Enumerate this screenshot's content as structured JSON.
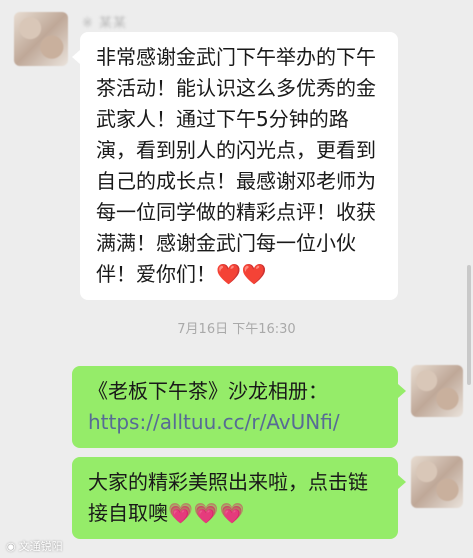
{
  "messages": {
    "incoming": {
      "sender_name": "※ 某某",
      "text_main": "非常感谢金武门下午举办的下午茶活动！能认识这么多优秀的金武家人！通过下午5分钟的路演，看到别人的闪光点，更看到自己的成长点！最感谢邓老师为每一位同学做的精彩点评！收获满满！感谢金武门每一位小伙伴！爱你们！",
      "emoji": "❤️❤️"
    },
    "timestamp": "7月16日 下午16:30",
    "outgoing": [
      {
        "prefix": "《老板下午茶》沙龙相册：",
        "link": "https://alltuu.cc/r/AvUNfi/"
      },
      {
        "text": "大家的精彩美照出来啦，点击链接自取噢",
        "emoji": "💗💗💗"
      }
    ]
  },
  "watermark": {
    "icon": "weibo-icon",
    "text": "文通锐阳"
  },
  "colors": {
    "background": "#ededed",
    "incoming_bubble": "#ffffff",
    "outgoing_bubble": "#95ec69",
    "link": "#576b95",
    "heart": "#e8243f"
  }
}
